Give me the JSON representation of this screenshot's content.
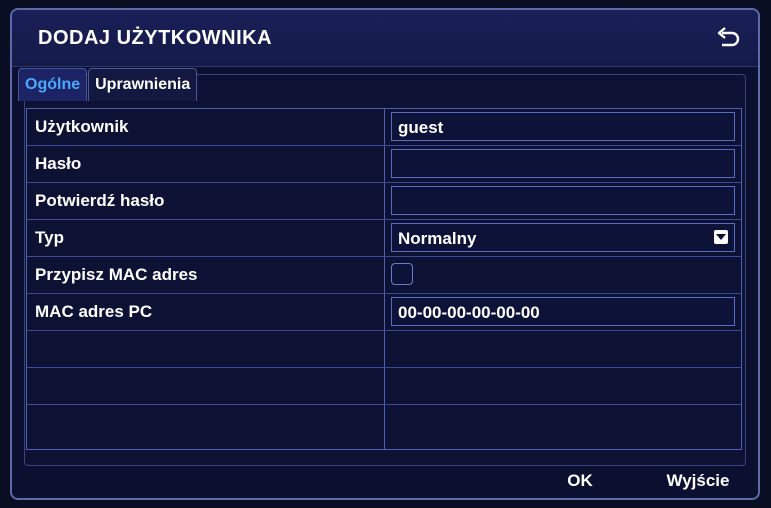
{
  "window": {
    "title": "DODAJ UŻYTKOWNIKA"
  },
  "tabs": [
    {
      "label": "Ogólne",
      "active": true
    },
    {
      "label": "Uprawnienia",
      "active": false
    }
  ],
  "form": {
    "user": {
      "label": "Użytkownik",
      "value": "guest"
    },
    "password": {
      "label": "Hasło",
      "value": ""
    },
    "confirm_password": {
      "label": "Potwierdź hasło",
      "value": ""
    },
    "type": {
      "label": "Typ",
      "value": "Normalny"
    },
    "bind_mac": {
      "label": "Przypisz MAC adres",
      "checked": false
    },
    "mac": {
      "label": "MAC adres PC",
      "value": "00-00-00-00-00-00"
    }
  },
  "buttons": {
    "ok": "OK",
    "exit": "Wyjście"
  },
  "colors": {
    "background": "#0b1030",
    "active_tab_text": "#4aa8ff",
    "grid_lines": "#4f60b0"
  }
}
